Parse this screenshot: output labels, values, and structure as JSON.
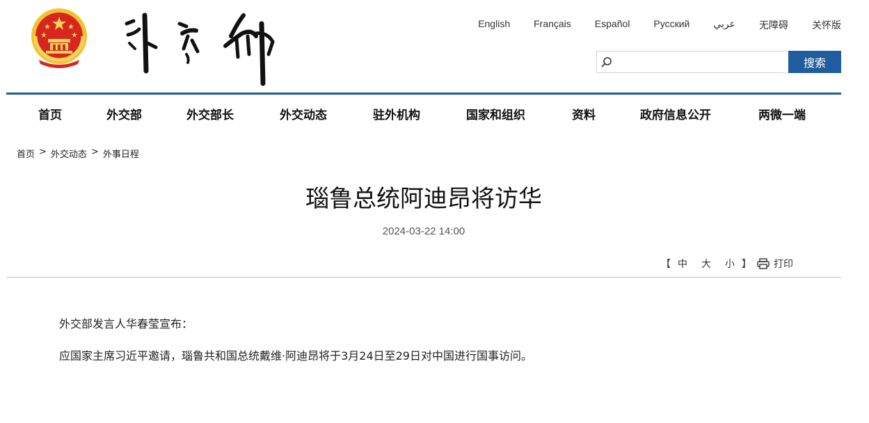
{
  "header": {
    "emblem_icon": "national-emblem-icon",
    "logo_icon": "ministry-calligraphy-logo",
    "languages": [
      "English",
      "Français",
      "Español",
      "Русский",
      "عربي",
      "无障碍",
      "关怀版"
    ],
    "search": {
      "placeholder": "",
      "button_label": "搜索"
    }
  },
  "nav": {
    "items": [
      "首页",
      "外交部",
      "外交部长",
      "外交动态",
      "驻外机构",
      "国家和组织",
      "资料",
      "政府信息公开",
      "两微一端"
    ]
  },
  "breadcrumb": [
    "首页",
    "外交动态",
    "外事日程"
  ],
  "breadcrumb_separator": ">",
  "article": {
    "title": "瑙鲁总统阿迪昂将访华",
    "date": "2024-03-22 14:00",
    "font_size_controls": {
      "open": "【",
      "large": "中",
      "medium": "大",
      "small": "小",
      "close": "】"
    },
    "print_label": "打印",
    "paragraphs": [
      "外交部发言人华春莹宣布：",
      "应国家主席习近平邀请，瑙鲁共和国总统戴维·阿迪昂将于3月24日至29日对中国进行国事访问。"
    ]
  },
  "colors": {
    "brand_blue": "#1f5d9e",
    "emblem_red": "#d7261e",
    "emblem_gold": "#f2c230"
  }
}
